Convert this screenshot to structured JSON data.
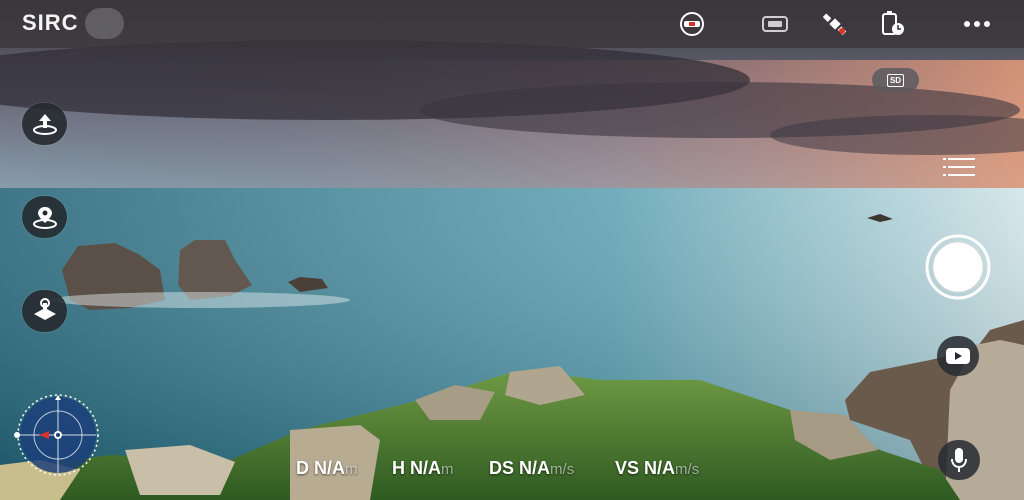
{
  "app": {
    "logo_text": "SIRC"
  },
  "top_bar": {
    "icons": [
      "remote-controller-icon",
      "camera-gimbal-icon",
      "satellite-icon",
      "battery-timer-icon",
      "more-options-icon"
    ]
  },
  "left_controls": {
    "icons": [
      "takeoff-icon",
      "location-pin-icon",
      "joystick-calibration-icon"
    ]
  },
  "right_controls": {
    "sd_badge": "SD",
    "icons": [
      "list-menu-icon",
      "shutter-button",
      "video-record-icon",
      "microphone-icon"
    ]
  },
  "telemetry": [
    {
      "label": "D",
      "value": "N/A",
      "unit": "m"
    },
    {
      "label": "H",
      "value": "N/A",
      "unit": "m"
    },
    {
      "label": "DS",
      "value": "N/A",
      "unit": "m/s"
    },
    {
      "label": "VS",
      "value": "N/A",
      "unit": "m/s"
    }
  ],
  "radar": {
    "icon": "compass-radar-icon"
  },
  "colors": {
    "topbar_bg": "#3a363a",
    "button_bg": "#262a30",
    "accent_red": "#d8332b",
    "text": "#ffffff"
  }
}
